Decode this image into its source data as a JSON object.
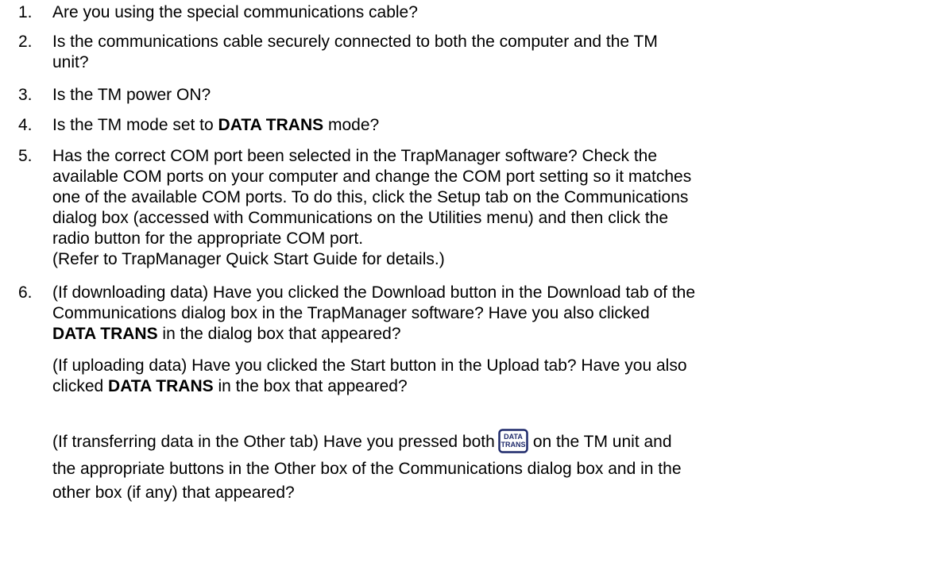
{
  "items": [
    {
      "num": "1.",
      "text": "Are you using the special communications cable?"
    },
    {
      "num": "2.",
      "line1": "Is the communications cable securely connected to both the computer and the TM",
      "line2": "unit?"
    },
    {
      "num": "3.",
      "text": "Is the TM power ON?"
    },
    {
      "num": "4.",
      "pre": "Is the TM mode set to ",
      "bold": "DATA TRANS",
      "post": " mode?"
    },
    {
      "num": "5.",
      "lines": [
        "Has the correct COM port been selected in the TrapManager software? Check the",
        "available COM ports on your computer and change the COM port setting so it matches",
        "one of the available COM ports. To do this, click the Setup tab on the Communications",
        "dialog box (accessed with Communications on the Utilities menu) and then click the",
        "radio button for the appropriate COM port.",
        "(Refer to TrapManager Quick Start Guide for details.)"
      ]
    },
    {
      "num": "6.",
      "line1": "(If downloading data) Have you clicked the Download button in the Download tab of the",
      "line2": "Communications dialog box in the TrapManager software? Have you also clicked",
      "line3_bold": "DATA TRANS",
      "line3_post": " in the dialog box that appeared?"
    }
  ],
  "para_upload": {
    "line1": "(If uploading data)  Have you clicked the Start button in the Upload tab? Have you also",
    "line2_pre": "clicked ",
    "line2_bold": "DATA TRANS",
    "line2_post": " in the box that appeared?"
  },
  "para_other": {
    "line1_pre": "(If transferring data in the Other tab) Have you pressed both",
    "line1_post": "on the TM unit and",
    "line2": "the appropriate buttons in the Other box of the Communications dialog box and in the",
    "line3": "other box (if any) that appeared?"
  },
  "key_icon": {
    "name": "data-trans-key-icon",
    "label_top": "DATA",
    "label_bottom": "TRANS",
    "color": "#1f2a6b"
  }
}
